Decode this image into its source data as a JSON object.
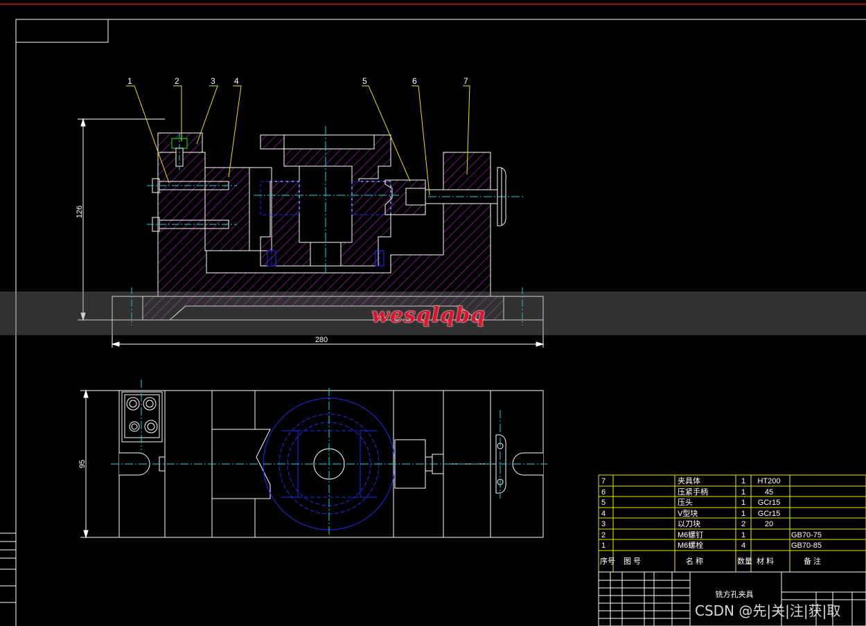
{
  "drawing": {
    "part_title": "铣方孔夹具",
    "balloons": [
      "1",
      "2",
      "3",
      "4",
      "5",
      "6",
      "7"
    ],
    "dimensions": {
      "height_front": "126",
      "width_front": "280",
      "height_top": "95"
    }
  },
  "bom": {
    "rows": [
      {
        "no": "7",
        "name": "夹具体",
        "qty": "1",
        "material": "HT200",
        "note": ""
      },
      {
        "no": "6",
        "name": "压紧手柄",
        "qty": "1",
        "material": "45",
        "note": ""
      },
      {
        "no": "5",
        "name": "压头",
        "qty": "1",
        "material": "GCr15",
        "note": ""
      },
      {
        "no": "4",
        "name": "V型块",
        "qty": "1",
        "material": "GCr15",
        "note": ""
      },
      {
        "no": "3",
        "name": "以刀块",
        "qty": "2",
        "material": "20",
        "note": ""
      },
      {
        "no": "2",
        "name": "M6螺钉",
        "qty": "1",
        "material": "",
        "note": "GB70-75"
      },
      {
        "no": "1",
        "name": "M6螺栓",
        "qty": "4",
        "material": "",
        "note": "GB70-85"
      }
    ],
    "headers": {
      "no": "序号",
      "drawing_no": "图      号",
      "name": "名      称",
      "qty": "数量",
      "material": "材   料",
      "note": "备            注"
    }
  },
  "watermark": {
    "text": "wesqlqbq",
    "credit": "CSDN @先|关|注|获|取"
  },
  "colors": {
    "outline": "#ffffff",
    "hatch": "#c020d0",
    "hidden": "#1a2cff",
    "center": "#00e0e0",
    "leader": "#e8e800",
    "frame": "#ffffff",
    "top_line": "#c81414",
    "green": "#00ff00"
  }
}
